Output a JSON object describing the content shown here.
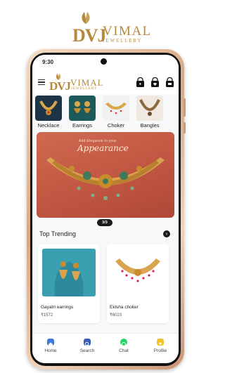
{
  "brand": {
    "monogram": "DVJ",
    "name": "VIMAL",
    "subtitle": "JEWELLERY"
  },
  "status_bar": {
    "time": "9:30"
  },
  "app_bar": {
    "monogram": "DVJ",
    "name": "VIMAL",
    "subtitle": "JEWELLERY"
  },
  "categories": [
    {
      "label": "Necklace"
    },
    {
      "label": "Earrings"
    },
    {
      "label": "Choker"
    },
    {
      "label": "Bangles"
    }
  ],
  "banner": {
    "tagline": "Add Elegance to your",
    "headline": "Appearance",
    "pager": "3/3"
  },
  "top_trending": {
    "title": "Top Trending",
    "products": [
      {
        "name": "Gayatri earrings",
        "price": "₹1572"
      },
      {
        "name": "Eklsha choker",
        "price": "₹6023"
      }
    ]
  },
  "tabs": [
    {
      "label": "Home",
      "active": true
    },
    {
      "label": "Search",
      "active": false
    },
    {
      "label": "Chat",
      "active": false
    },
    {
      "label": "Profile",
      "active": false
    }
  ],
  "colors": {
    "gold": "#b58a3c",
    "accent": "#3a7ad6",
    "banner": "#c45a44"
  }
}
